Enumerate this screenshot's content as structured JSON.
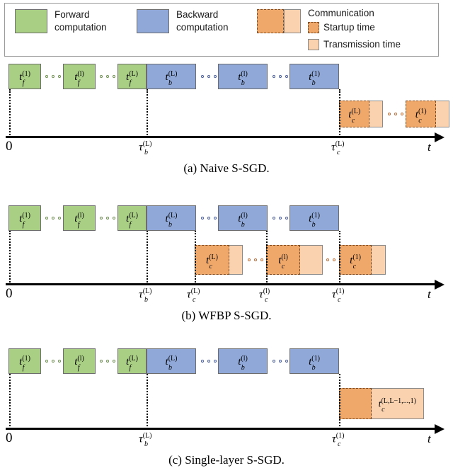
{
  "legend": {
    "items": [
      {
        "name": "forward",
        "label_line1": "Forward",
        "label_line2": "computation",
        "color": "#a8cf84"
      },
      {
        "name": "backward",
        "label_line1": "Backward",
        "label_line2": "computation",
        "color": "#8fa8d8"
      },
      {
        "name": "communication",
        "label_line1": "Communication",
        "color_startup": "#f0a76a",
        "color_transmission": "#fad2b0"
      }
    ],
    "communication_sub": [
      {
        "name": "startup",
        "label": "Startup time",
        "color": "#f0a76a",
        "border": "dashed"
      },
      {
        "name": "transmission",
        "label": "Transmission time",
        "color": "#fad2b0",
        "border": "solid"
      }
    ]
  },
  "colors": {
    "forward": "#a8cf84",
    "backward": "#8fa8d8",
    "startup": "#f0a76a",
    "transmission": "#fad2b0",
    "axis": "#000000"
  },
  "panels": [
    {
      "id": "a",
      "caption": "(a) Naive S-SGD.",
      "forward_blocks": [
        {
          "base": "t",
          "sub": "f",
          "sup": "(1)"
        },
        {
          "base": "t",
          "sub": "f",
          "sup": "(l)"
        },
        {
          "base": "t",
          "sub": "f",
          "sup": "(L)"
        }
      ],
      "backward_blocks": [
        {
          "base": "t",
          "sub": "b",
          "sup": "(L)"
        },
        {
          "base": "t",
          "sub": "b",
          "sup": "(l)"
        },
        {
          "base": "t",
          "sub": "b",
          "sup": "(1)"
        }
      ],
      "comm_blocks": [
        {
          "base": "t",
          "sub": "c",
          "sup": "(L)"
        },
        {
          "base": "t",
          "sub": "c",
          "sup": "(1)"
        }
      ],
      "ticks": [
        {
          "label": "0",
          "type": "plain"
        },
        {
          "base": "τ",
          "sub": "b",
          "sup": "(L)",
          "type": "math"
        },
        {
          "base": "τ",
          "sub": "c",
          "sup": "(L)",
          "type": "math"
        },
        {
          "label": "t",
          "type": "axis-name"
        }
      ]
    },
    {
      "id": "b",
      "caption": "(b) WFBP S-SGD.",
      "forward_blocks": [
        {
          "base": "t",
          "sub": "f",
          "sup": "(1)"
        },
        {
          "base": "t",
          "sub": "f",
          "sup": "(l)"
        },
        {
          "base": "t",
          "sub": "f",
          "sup": "(L)"
        }
      ],
      "backward_blocks": [
        {
          "base": "t",
          "sub": "b",
          "sup": "(L)"
        },
        {
          "base": "t",
          "sub": "b",
          "sup": "(l)"
        },
        {
          "base": "t",
          "sub": "b",
          "sup": "(1)"
        }
      ],
      "comm_blocks": [
        {
          "base": "t",
          "sub": "c",
          "sup": "(L)"
        },
        {
          "base": "t",
          "sub": "c",
          "sup": "(l)"
        },
        {
          "base": "t",
          "sub": "c",
          "sup": "(1)"
        }
      ],
      "ticks": [
        {
          "label": "0",
          "type": "plain"
        },
        {
          "base": "τ",
          "sub": "b",
          "sup": "(L)",
          "type": "math"
        },
        {
          "base": "τ",
          "sub": "c",
          "sup": "(L)",
          "type": "math"
        },
        {
          "base": "τ",
          "sub": "c",
          "sup": "(l)",
          "type": "math"
        },
        {
          "base": "τ",
          "sub": "c",
          "sup": "(1)",
          "type": "math"
        },
        {
          "label": "t",
          "type": "axis-name"
        }
      ]
    },
    {
      "id": "c",
      "caption": "(c) Single-layer S-SGD.",
      "forward_blocks": [
        {
          "base": "t",
          "sub": "f",
          "sup": "(1)"
        },
        {
          "base": "t",
          "sub": "f",
          "sup": "(l)"
        },
        {
          "base": "t",
          "sub": "f",
          "sup": "(L)"
        }
      ],
      "backward_blocks": [
        {
          "base": "t",
          "sub": "b",
          "sup": "(L)"
        },
        {
          "base": "t",
          "sub": "b",
          "sup": "(l)"
        },
        {
          "base": "t",
          "sub": "b",
          "sup": "(1)"
        }
      ],
      "comm_blocks": [
        {
          "base": "t",
          "sub": "c",
          "sup": "(L,L−1,...,1)"
        }
      ],
      "ticks": [
        {
          "label": "0",
          "type": "plain"
        },
        {
          "base": "τ",
          "sub": "b",
          "sup": "(L)",
          "type": "math"
        },
        {
          "base": "τ",
          "sub": "c",
          "sup": "(1)",
          "type": "math"
        },
        {
          "label": "t",
          "type": "axis-name"
        }
      ]
    }
  ]
}
